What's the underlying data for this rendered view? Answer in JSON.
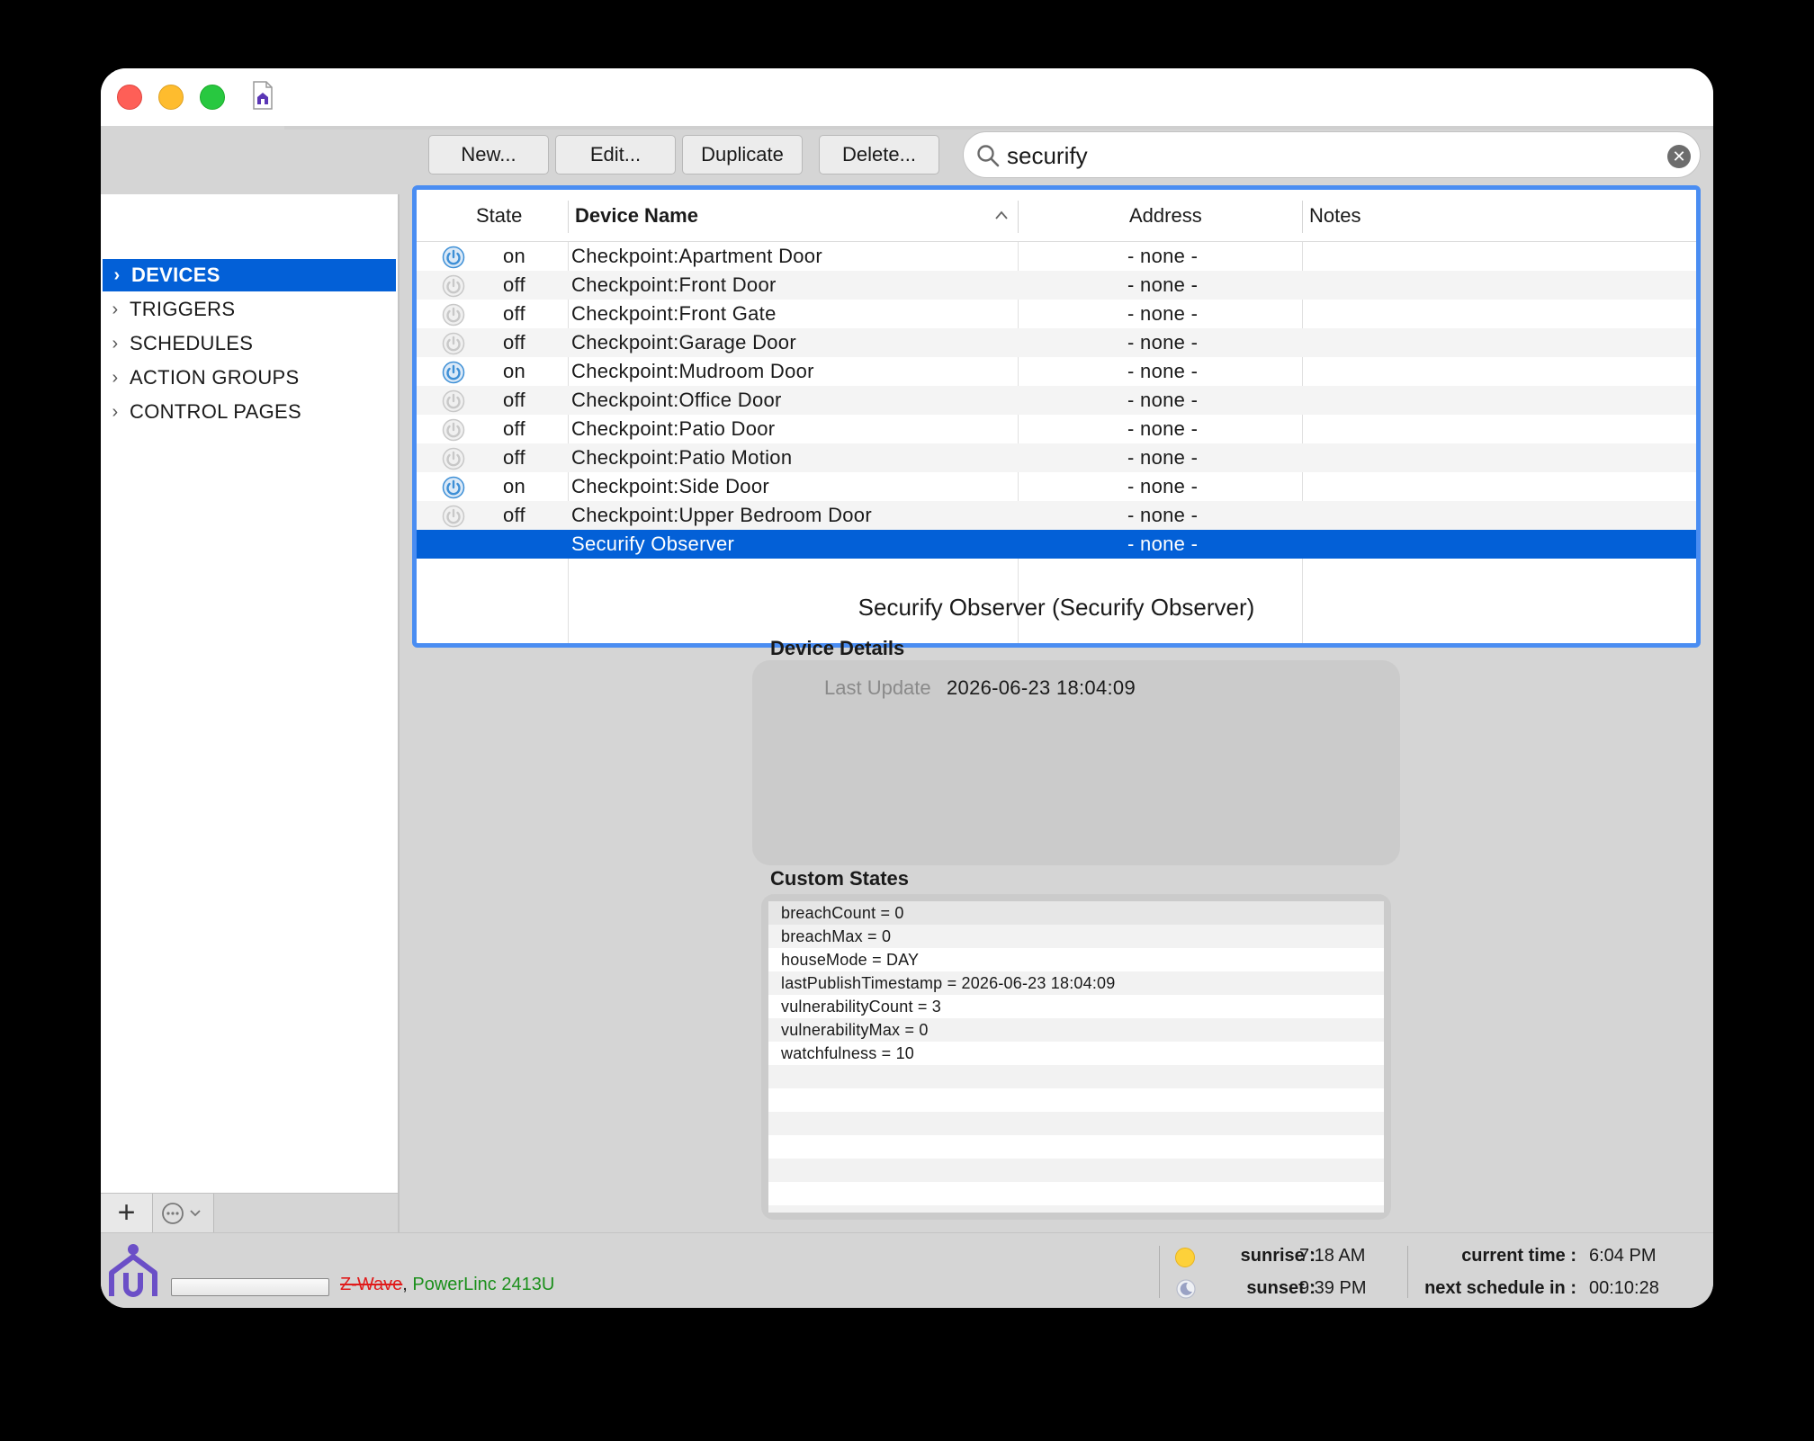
{
  "toolbar": {
    "new_label": "New...",
    "edit_label": "Edit...",
    "duplicate_label": "Duplicate",
    "delete_label": "Delete..."
  },
  "search": {
    "value": "securify",
    "clear_icon": "clear-icon"
  },
  "sidebar": {
    "items": [
      {
        "label": "DEVICES",
        "selected": true
      },
      {
        "label": "TRIGGERS",
        "selected": false
      },
      {
        "label": "SCHEDULES",
        "selected": false
      },
      {
        "label": "ACTION GROUPS",
        "selected": false
      },
      {
        "label": "CONTROL PAGES",
        "selected": false
      }
    ]
  },
  "table": {
    "columns": {
      "state": "State",
      "device_name": "Device Name",
      "address": "Address",
      "notes": "Notes"
    },
    "rows": [
      {
        "state": "on",
        "name": "Checkpoint:Apartment Door",
        "address": "- none -",
        "notes": ""
      },
      {
        "state": "off",
        "name": "Checkpoint:Front Door",
        "address": "- none -",
        "notes": ""
      },
      {
        "state": "off",
        "name": "Checkpoint:Front Gate",
        "address": "- none -",
        "notes": ""
      },
      {
        "state": "off",
        "name": "Checkpoint:Garage Door",
        "address": "- none -",
        "notes": ""
      },
      {
        "state": "on",
        "name": "Checkpoint:Mudroom Door",
        "address": "- none -",
        "notes": ""
      },
      {
        "state": "off",
        "name": "Checkpoint:Office Door",
        "address": "- none -",
        "notes": ""
      },
      {
        "state": "off",
        "name": "Checkpoint:Patio Door",
        "address": "- none -",
        "notes": ""
      },
      {
        "state": "off",
        "name": "Checkpoint:Patio Motion",
        "address": "- none -",
        "notes": ""
      },
      {
        "state": "on",
        "name": "Checkpoint:Side Door",
        "address": "- none -",
        "notes": ""
      },
      {
        "state": "off",
        "name": "Checkpoint:Upper Bedroom Door",
        "address": "- none -",
        "notes": ""
      },
      {
        "state": "",
        "name": "Securify Observer",
        "address": "- none -",
        "notes": ""
      }
    ]
  },
  "detail": {
    "title": "Securify Observer (Securify Observer)",
    "device_details_label": "Device Details",
    "last_update_label": "Last Update",
    "last_update_value": "2026-06-23 18:04:09",
    "custom_states_label": "Custom States",
    "custom_states": [
      "breachCount = 0",
      "breachMax = 0",
      "houseMode = DAY",
      "lastPublishTimestamp = 2026-06-23 18:04:09",
      "vulnerabilityCount = 3",
      "vulnerabilityMax = 0",
      "watchfulness = 10"
    ]
  },
  "status": {
    "interface_zwave": "Z-Wave",
    "interface_separator": ",",
    "interface_powerlinc": "PowerLinc 2413U",
    "sunrise_label": "sunrise :",
    "sunrise_value": "7:18 AM",
    "sunset_label": "sunset :",
    "sunset_value": "9:39 PM",
    "current_time_label": "current time :",
    "current_time_value": "6:04 PM",
    "next_schedule_label": "next schedule in :",
    "next_schedule_value": "00:10:28"
  },
  "colors": {
    "selection": "#0360d7",
    "focus_ring": "#4a8df2",
    "power_on": "#3d8fd6",
    "power_off": "#c8c8c8",
    "zwave_disabled": "#e01b1b",
    "powerlinc_ok": "#1b8f1b",
    "logo": "#6b4fc7"
  }
}
